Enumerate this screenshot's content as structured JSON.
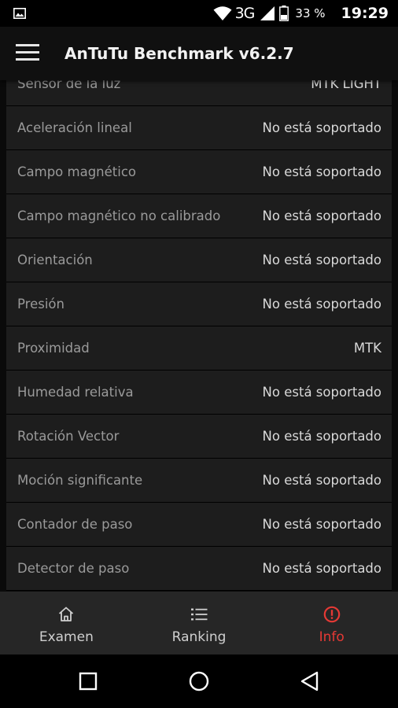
{
  "status_bar": {
    "network": "3G",
    "battery": "33 %",
    "time": "19:29"
  },
  "app_bar": {
    "title": "AnTuTu Benchmark v6.2.7"
  },
  "sensors": [
    {
      "label": "Sensor de la luz",
      "value": "MTK LIGHT"
    },
    {
      "label": "Aceleración lineal",
      "value": "No está soportado"
    },
    {
      "label": "Campo magnético",
      "value": "No está soportado"
    },
    {
      "label": "Campo magnético no calibrado",
      "value": "No está soportado"
    },
    {
      "label": "Orientación",
      "value": "No está soportado"
    },
    {
      "label": "Presión",
      "value": "No está soportado"
    },
    {
      "label": "Proximidad",
      "value": "MTK"
    },
    {
      "label": "Humedad relativa",
      "value": "No está soportado"
    },
    {
      "label": "Rotación Vector",
      "value": "No está soportado"
    },
    {
      "label": "Moción significante",
      "value": "No está soportado"
    },
    {
      "label": "Contador de paso",
      "value": "No está soportado"
    },
    {
      "label": "Detector de paso",
      "value": "No está soportado"
    }
  ],
  "bottom_nav": {
    "items": [
      {
        "label": "Examen",
        "icon": "home-icon"
      },
      {
        "label": "Ranking",
        "icon": "list-icon"
      },
      {
        "label": "Info",
        "icon": "alert-circle-icon"
      }
    ],
    "active_index": 2
  },
  "colors": {
    "accent": "#e53935",
    "row_background": "#1d1d1d",
    "nav_background": "#262626"
  }
}
